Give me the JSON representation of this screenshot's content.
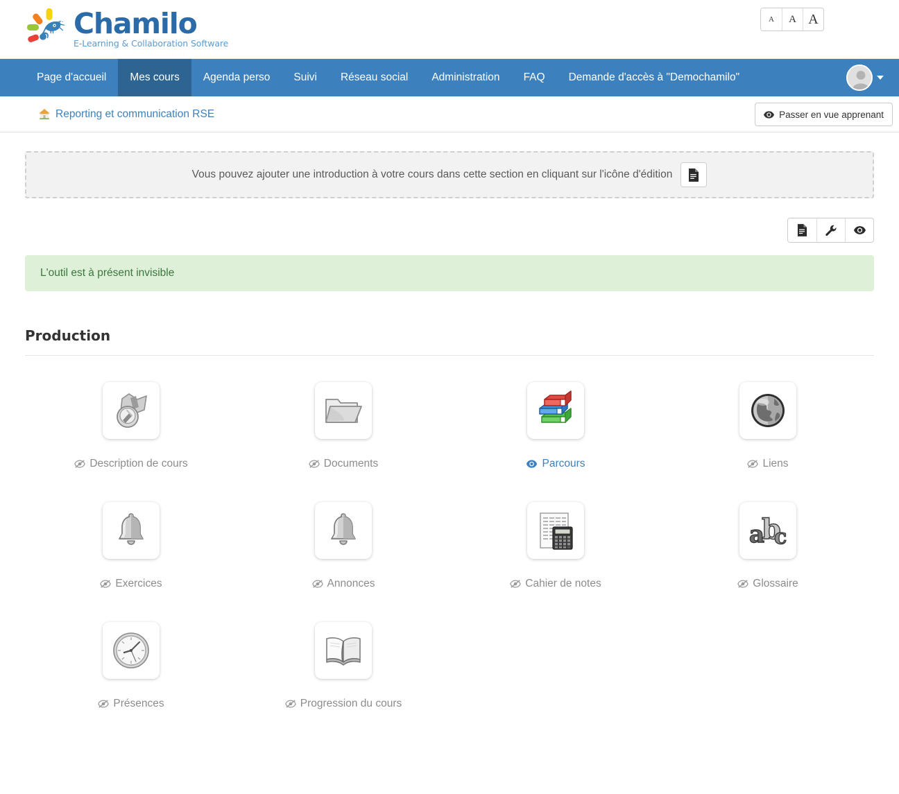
{
  "brand": {
    "name": "Chamilo",
    "tagline": "E-Learning & Collaboration Software",
    "logo_colors": {
      "blue": "#2a6ba8",
      "sub_blue": "#5b9bd0",
      "ray_red": "#e8413a",
      "ray_green": "#9ac63b",
      "ray_orange": "#f08020",
      "ray_yellow": "#f5d312"
    }
  },
  "font_sizer": {
    "small_label": "A",
    "medium_label": "A",
    "large_label": "A"
  },
  "nav": {
    "accent": "#3c81bd",
    "active_accent": "#2d6491",
    "items": [
      {
        "label": "Page d'accueil",
        "active": false
      },
      {
        "label": "Mes cours",
        "active": true
      },
      {
        "label": "Agenda perso",
        "active": false
      },
      {
        "label": "Suivi",
        "active": false
      },
      {
        "label": "Réseau social",
        "active": false
      },
      {
        "label": "Administration",
        "active": false
      },
      {
        "label": "FAQ",
        "active": false
      },
      {
        "label": "Demande d'accès à \"Demochamilo\"",
        "active": false
      }
    ]
  },
  "breadcrumb": {
    "course_label": "Reporting et communication RSE",
    "view_switch_label": "Passer en vue apprenant"
  },
  "intro": {
    "text": "Vous pouvez ajouter une introduction à votre cours dans cette section en cliquant sur l'icône d'édition"
  },
  "toolbar": {
    "buttons": [
      "edit-document",
      "wrench",
      "eye"
    ]
  },
  "alert": {
    "message": "L'outil est à présent invisible",
    "background": "#dff0d8",
    "color": "#3c763d"
  },
  "section": {
    "title": "Production"
  },
  "tools": [
    {
      "label": "Description de cours",
      "icon": "course-description-icon",
      "visible": false
    },
    {
      "label": "Documents",
      "icon": "folder-icon",
      "visible": false
    },
    {
      "label": "Parcours",
      "icon": "learning-path-books-icon",
      "visible": true
    },
    {
      "label": "Liens",
      "icon": "globe-icon",
      "visible": false
    },
    {
      "label": "Exercices",
      "icon": "bell-icon",
      "visible": false
    },
    {
      "label": "Annonces",
      "icon": "bell-icon",
      "visible": false
    },
    {
      "label": "Cahier de notes",
      "icon": "gradebook-calculator-icon",
      "visible": false
    },
    {
      "label": "Glossaire",
      "icon": "abc-glossary-icon",
      "visible": false
    },
    {
      "label": "Présences",
      "icon": "clock-icon",
      "visible": false
    },
    {
      "label": "Progression du cours",
      "icon": "open-book-icon",
      "visible": false
    }
  ]
}
